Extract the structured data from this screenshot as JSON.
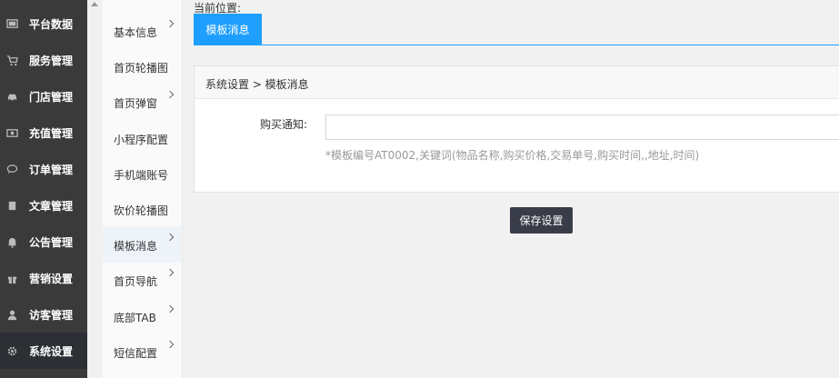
{
  "sidebar": {
    "items": [
      {
        "label": "平台数据",
        "icon": "monitor-icon"
      },
      {
        "label": "服务管理",
        "icon": "cart-icon"
      },
      {
        "label": "门店管理",
        "icon": "car-icon"
      },
      {
        "label": "充值管理",
        "icon": "money-icon"
      },
      {
        "label": "订单管理",
        "icon": "comment-icon"
      },
      {
        "label": "文章管理",
        "icon": "book-icon"
      },
      {
        "label": "公告管理",
        "icon": "bell-icon"
      },
      {
        "label": "营销设置",
        "icon": "gift-icon"
      },
      {
        "label": "访客管理",
        "icon": "user-icon"
      },
      {
        "label": "系统设置",
        "icon": "gear-icon",
        "active": true
      }
    ]
  },
  "submenu": {
    "items": [
      {
        "label": "基本信息",
        "chevron": true
      },
      {
        "label": "首页轮播图",
        "chevron": false
      },
      {
        "label": "首页弹窗",
        "chevron": true
      },
      {
        "label": "小程序配置",
        "chevron": false
      },
      {
        "label": "手机端账号",
        "chevron": false
      },
      {
        "label": "砍价轮播图",
        "chevron": false
      },
      {
        "label": "模板消息",
        "chevron": true,
        "active": true
      },
      {
        "label": "首页导航",
        "chevron": true
      },
      {
        "label": "底部TAB",
        "chevron": true
      },
      {
        "label": "短信配置",
        "chevron": true
      }
    ]
  },
  "main": {
    "location_label": "当前位置:",
    "active_tab": "模板消息",
    "panel": {
      "breadcrumb": "系统设置 > 模板消息",
      "field_label": "购买通知:",
      "field_value": "",
      "hint": "*模板编号AT0002,关键词(物品名称,购买价格,交易单号,购买时间,,地址,时间)"
    },
    "save_label": "保存设置"
  },
  "colors": {
    "sidebar_bg": "#3a3a3a",
    "accent": "#1e9fff",
    "button_bg": "#393d49"
  }
}
